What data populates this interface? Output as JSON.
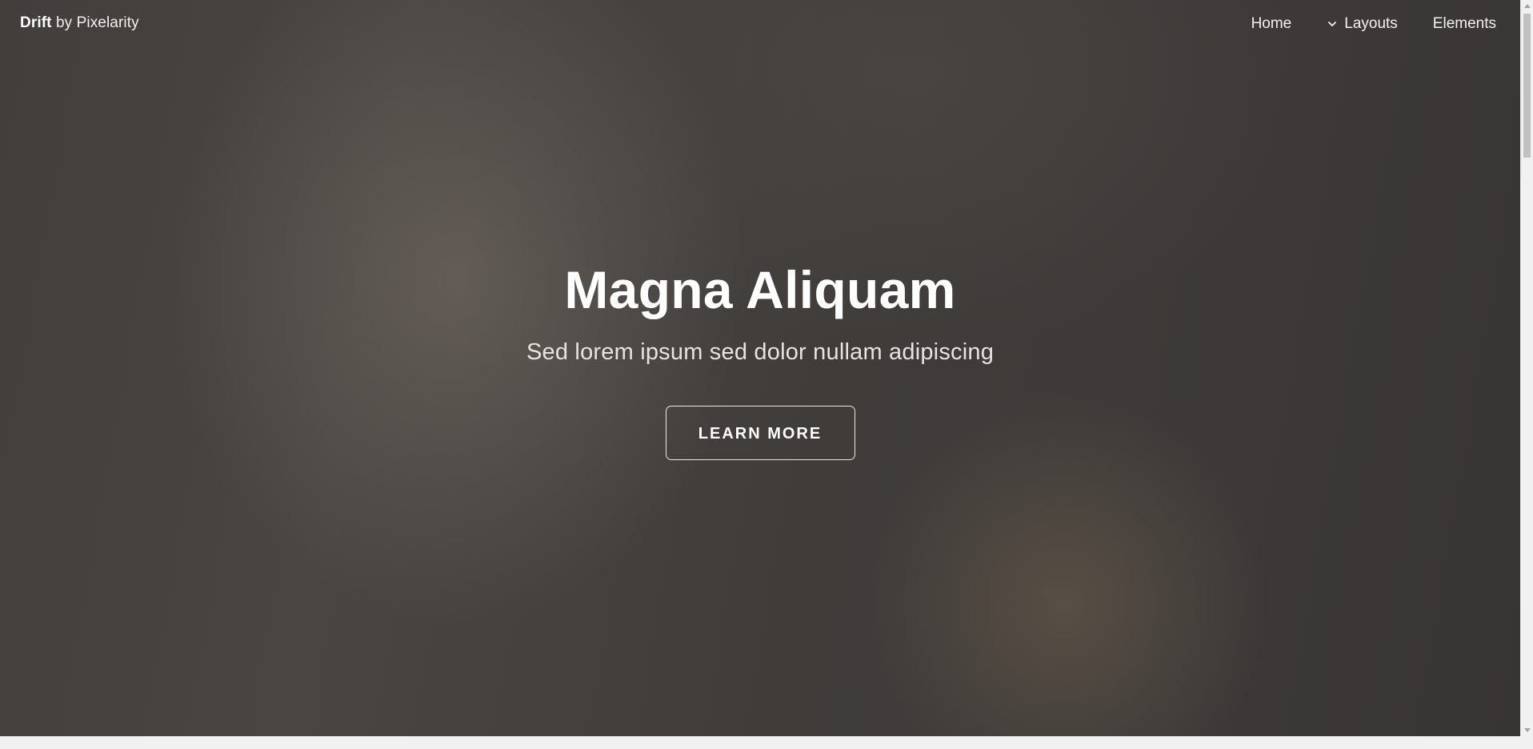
{
  "brand": {
    "name": "Drift",
    "byline": "by Pixelarity"
  },
  "nav": {
    "items": [
      {
        "label": "Home",
        "icon": null
      },
      {
        "label": "Layouts",
        "icon": "chevron-down-icon"
      },
      {
        "label": "Elements",
        "icon": null
      }
    ]
  },
  "hero": {
    "title": "Magna Aliquam",
    "subtitle": "Sed lorem ipsum sed dolor nullam adipiscing",
    "button_label": "LEARN MORE"
  },
  "colors": {
    "hero_background": "#403d3b",
    "text": "#ffffff",
    "page_background": "#f1f1f1"
  }
}
